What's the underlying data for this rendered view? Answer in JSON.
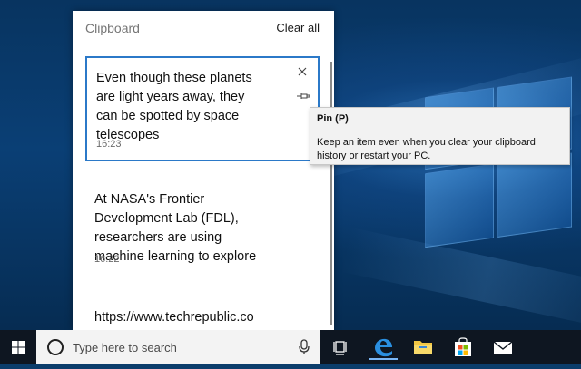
{
  "clipboard": {
    "title": "Clipboard",
    "clear_all_label": "Clear all",
    "items": [
      {
        "text": "Even though these planets are light years away, they can be spotted by space telescopes",
        "time": "16:23"
      },
      {
        "text": "At NASA's Frontier Development Lab (FDL), researchers are using machine learning to explore",
        "time": "16:22"
      },
      {
        "text": "https://www.techrepublic.com/article/hunting-alien-planets-and-"
      }
    ]
  },
  "tooltip": {
    "title": "Pin (P)",
    "body": "Keep an item even when you clear your clipboard history or restart your PC."
  },
  "taskbar": {
    "search_placeholder": "Type here to search",
    "icons": [
      "windows-start-icon",
      "cortana-icon",
      "microphone-icon",
      "task-view-icon",
      "edge-icon",
      "file-explorer-icon",
      "store-icon",
      "mail-icon"
    ]
  },
  "colors": {
    "accent": "#2b79c8",
    "taskbar": "#0e1621",
    "desktop": "#0a3f75"
  }
}
